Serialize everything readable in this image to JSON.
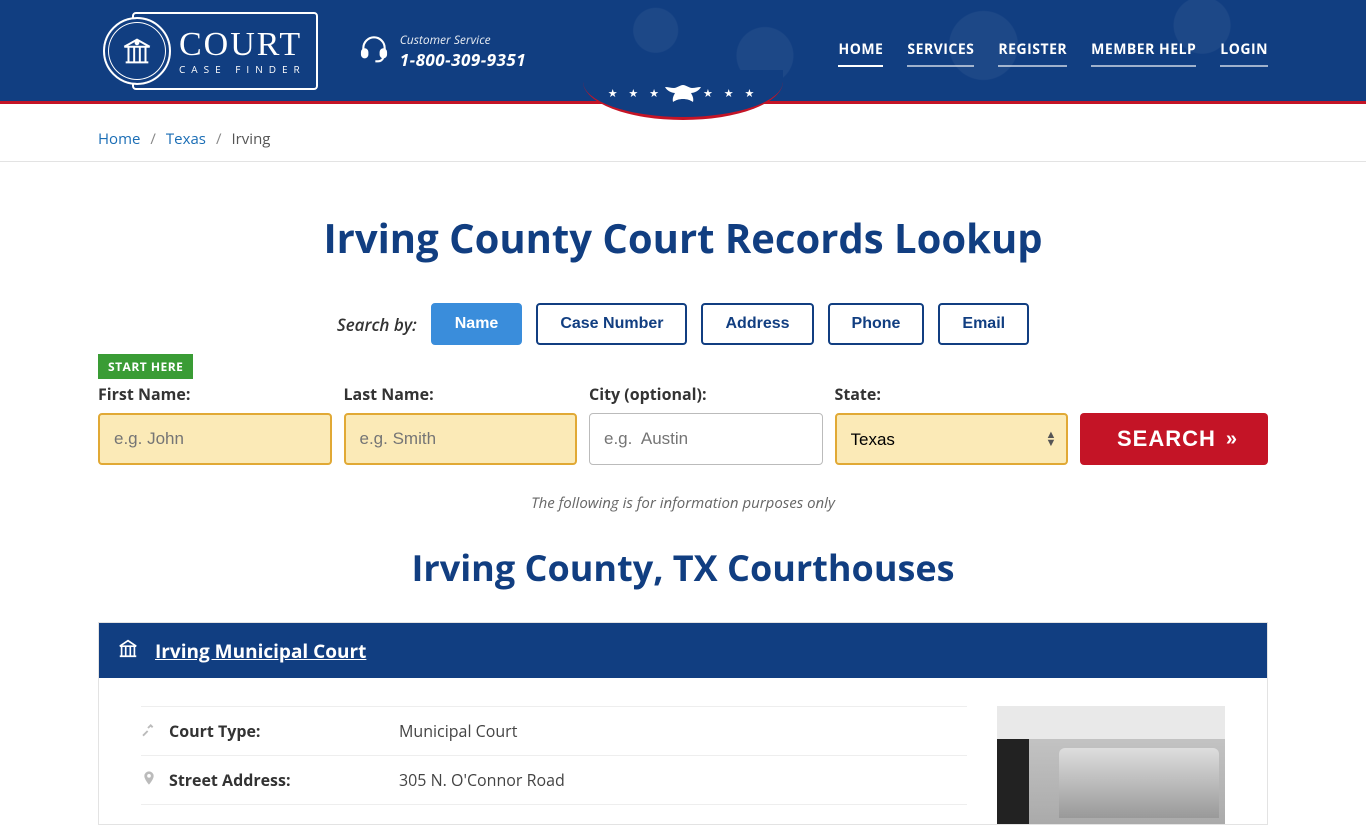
{
  "brand": {
    "main": "COURT",
    "sub": "CASE FINDER"
  },
  "customer_service": {
    "label": "Customer Service",
    "phone": "1-800-309-9351"
  },
  "nav": {
    "home": "HOME",
    "services": "SERVICES",
    "register": "REGISTER",
    "member_help": "MEMBER HELP",
    "login": "LOGIN"
  },
  "breadcrumb": {
    "home": "Home",
    "texas": "Texas",
    "current": "Irving"
  },
  "page_title": "Irving County Court Records Lookup",
  "search_by_label": "Search by:",
  "tabs": {
    "name": "Name",
    "case_number": "Case Number",
    "address": "Address",
    "phone": "Phone",
    "email": "Email"
  },
  "start_here": "START HERE",
  "fields": {
    "first_name": {
      "label": "First Name:",
      "placeholder": "e.g. John"
    },
    "last_name": {
      "label": "Last Name:",
      "placeholder": "e.g. Smith"
    },
    "city": {
      "label": "City (optional):",
      "placeholder": "e.g.  Austin"
    },
    "state": {
      "label": "State:",
      "value": "Texas"
    }
  },
  "search_button": "SEARCH",
  "disclaimer": "The following is for information purposes only",
  "section_title": "Irving County, TX Courthouses",
  "courthouse": {
    "name": "Irving Municipal Court",
    "props": {
      "court_type": {
        "label": "Court Type:",
        "value": "Municipal Court"
      },
      "street": {
        "label": "Street Address:",
        "value": "305 N. O'Connor Road"
      }
    }
  }
}
